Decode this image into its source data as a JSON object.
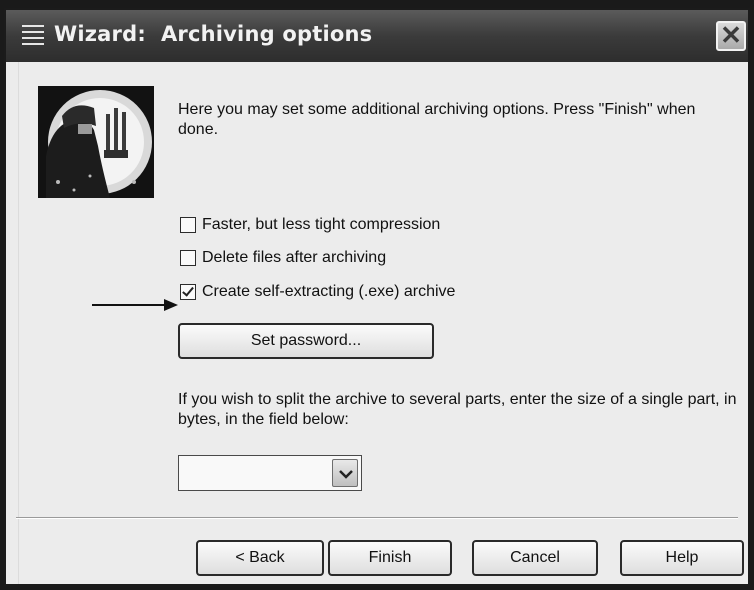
{
  "window": {
    "title": "Wizard:  Archiving options",
    "close_glyph": "✕",
    "title_icon": "list-icon"
  },
  "intro_text": "Here you may set some additional archiving options. Press \"Finish\" when done.",
  "options": [
    {
      "label": "Faster, but less tight compression",
      "checked": false
    },
    {
      "label": "Delete files after archiving",
      "checked": false
    },
    {
      "label": "Create self-extracting (.exe) archive",
      "checked": true
    }
  ],
  "set_password_label": "Set password...",
  "split_text": "If you wish to split the archive to several parts, enter the size of a single part, in bytes, in the field below:",
  "split_size_value": "",
  "buttons": {
    "back": "< Back",
    "finish": "Finish",
    "cancel": "Cancel",
    "help": "Help"
  },
  "colors": {
    "titlebar": "#3b3b3b",
    "dialog_bg": "#ececec"
  }
}
